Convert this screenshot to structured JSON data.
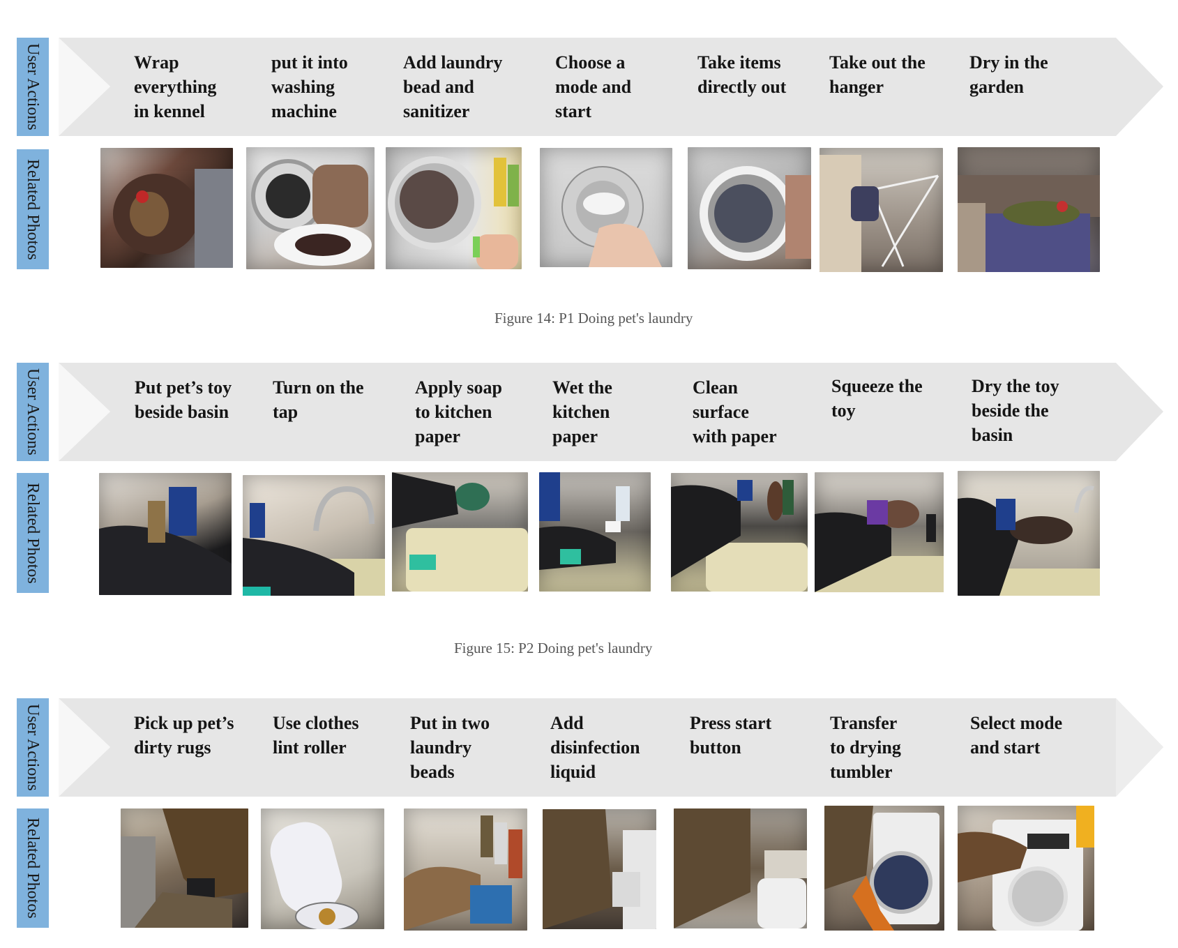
{
  "labels": {
    "user_actions": "User Actions",
    "related_photos": "Related Photos"
  },
  "figures": [
    {
      "caption": "Figure 14: P1 Doing pet's laundry",
      "steps": [
        "Wrap\neverything\nin kennel",
        "put it into\nwashing\nmachine",
        "Add laundry\nbead and\nsanitizer",
        "Choose a\nmode and\nstart",
        "Take items\ndirectly out",
        "Take out the\nhanger",
        "Dry in the\ngarden"
      ],
      "photos": [
        "photo-kennel-wrap-icon",
        "photo-washing-machine-load-icon",
        "photo-laundry-bead-icon",
        "photo-mode-dial-icon",
        "photo-take-out-items-icon",
        "photo-hanger-icon",
        "photo-garden-dry-icon"
      ]
    },
    {
      "caption": "Figure 15: P2 Doing pet's laundry",
      "steps": [
        "Put pet’s toy\nbeside basin",
        "Turn on the\ntap",
        "Apply soap\nto  kitchen\npaper",
        "Wet the\nkitchen\npaper",
        "Clean\nsurface\nwith paper",
        "Squeeze the\ntoy",
        "Dry the toy\nbeside the\nbasin"
      ],
      "photos": [
        "photo-toy-basin-icon",
        "photo-tap-icon",
        "photo-soap-paper-icon",
        "photo-wet-paper-icon",
        "photo-clean-surface-icon",
        "photo-squeeze-toy-icon",
        "photo-dry-toy-icon"
      ]
    },
    {
      "caption": "",
      "steps": [
        "Pick up pet’s\ndirty rugs",
        "Use clothes\nlint roller",
        "Put in two\nlaundry\nbeads",
        "Add\ndisinfection\nliquid",
        "Press start\nbutton",
        "Transfer\nto drying\ntumbler",
        "Select mode\nand start"
      ],
      "photos": [
        "photo-dirty-rugs-icon",
        "photo-lint-roller-icon",
        "photo-laundry-beads-icon",
        "photo-disinfection-liquid-icon",
        "photo-start-button-icon",
        "photo-drying-tumbler-icon",
        "photo-select-mode-icon"
      ]
    }
  ],
  "colors": {
    "label_bg": "#7fb2dd",
    "banner_bg": "#e6e6e6",
    "banner_notch": "#f7f7f7",
    "caption_text": "#555555"
  }
}
